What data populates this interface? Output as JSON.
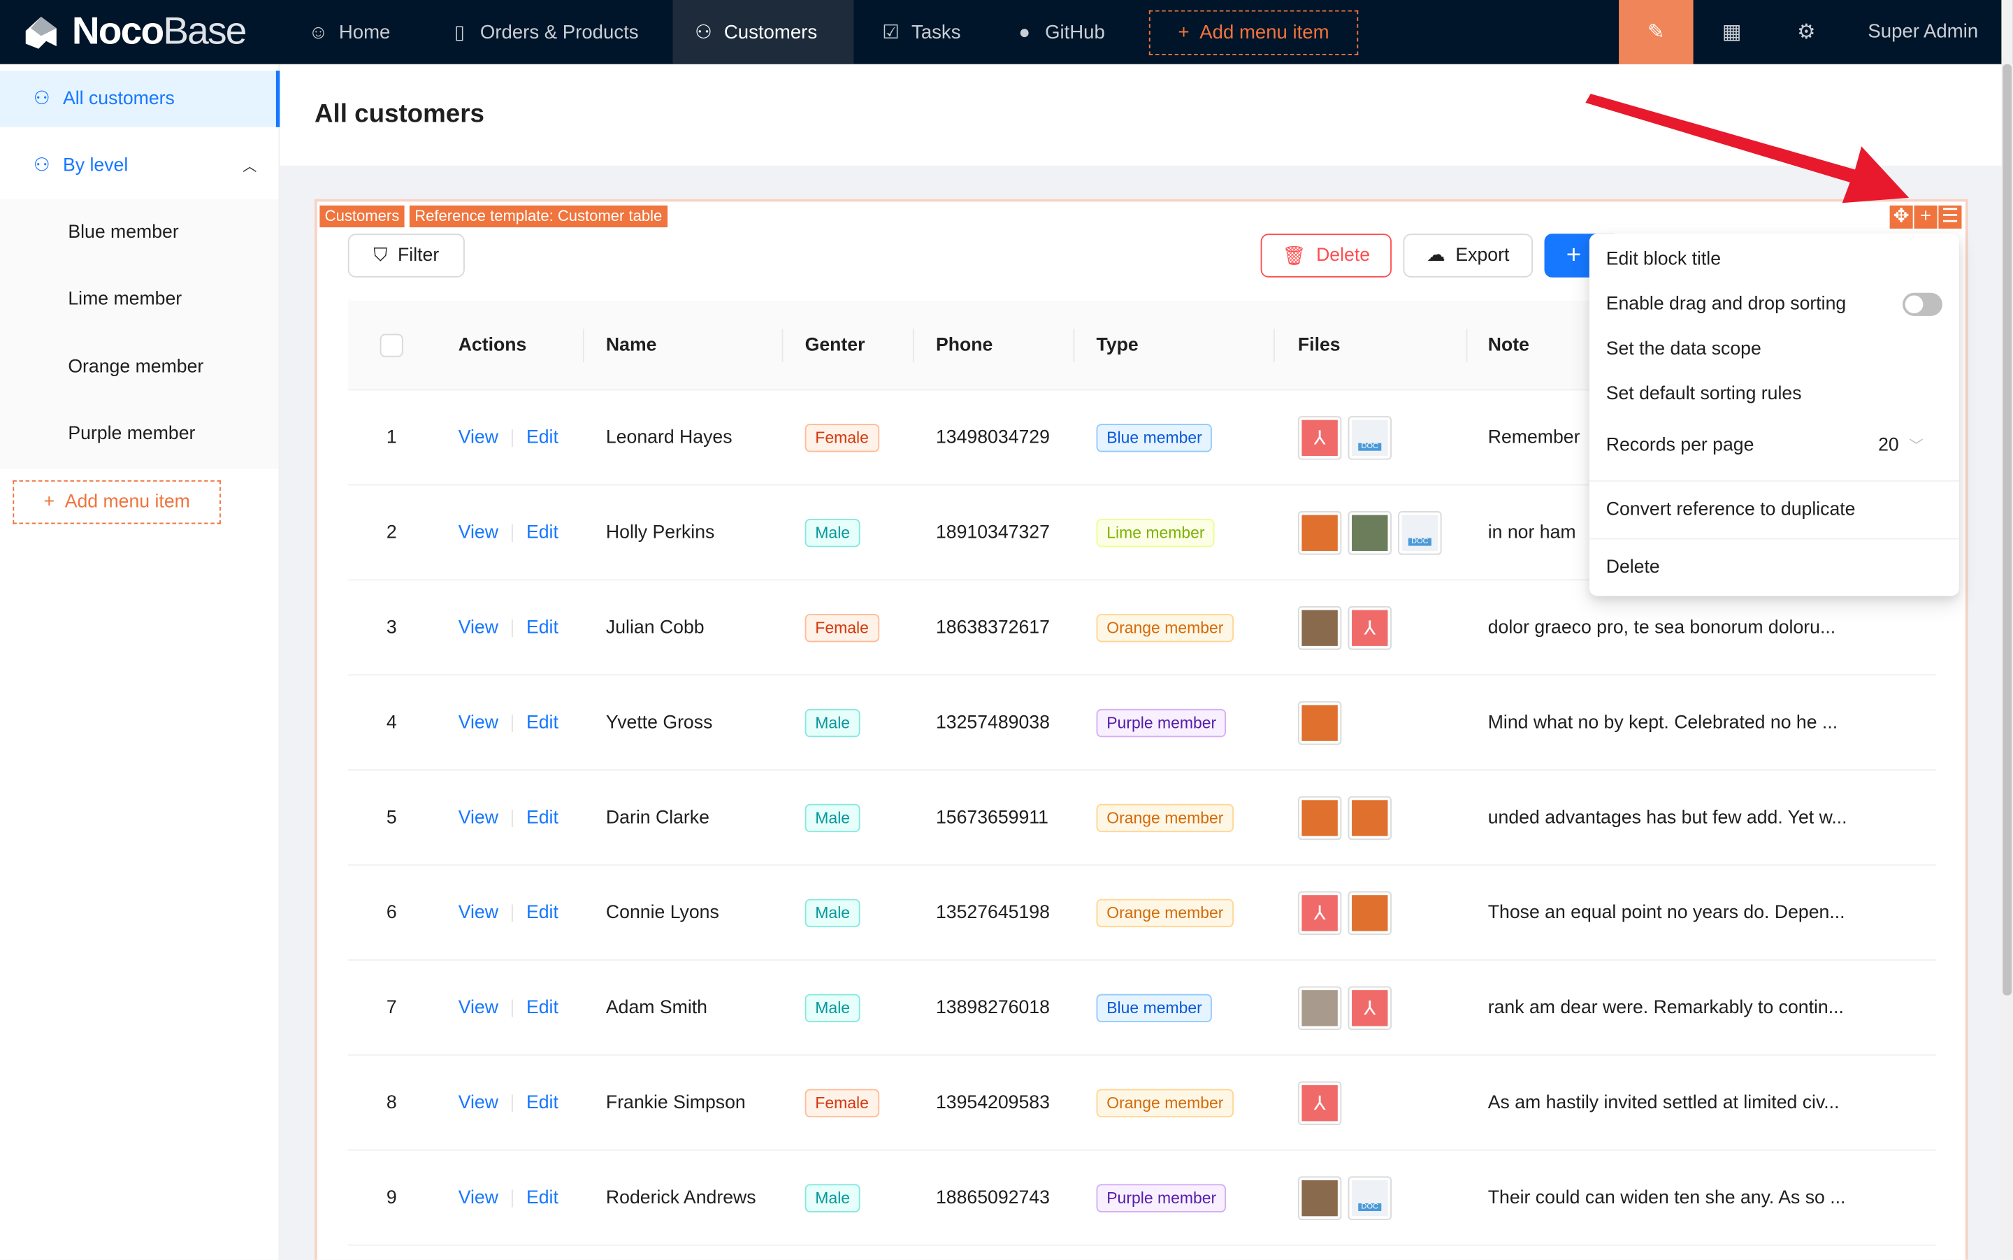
{
  "topbar": {
    "logo": {
      "bold": "Noco",
      "light": "Base"
    },
    "nav": [
      {
        "label": "Home",
        "icon": "smile-icon"
      },
      {
        "label": "Orders & Products",
        "icon": "file-check-icon"
      },
      {
        "label": "Customers",
        "icon": "users-icon",
        "active": true
      },
      {
        "label": "Tasks",
        "icon": "checkbox-icon"
      },
      {
        "label": "GitHub",
        "icon": "github-icon"
      }
    ],
    "add_menu_item": "Add menu item",
    "user": "Super Admin"
  },
  "sidebar": {
    "items": [
      {
        "label": "All customers",
        "selected": true
      },
      {
        "label": "By level",
        "expanded": true
      }
    ],
    "sub_items": [
      "Blue member",
      "Lime member",
      "Orange member",
      "Purple member"
    ],
    "add_menu_item": "Add menu item"
  },
  "page": {
    "title": "All customers"
  },
  "block": {
    "tags": [
      "Customers",
      "Reference template: Customer table"
    ],
    "filter": "Filter",
    "delete": "Delete",
    "export": "Export",
    "add": "+"
  },
  "table": {
    "columns": [
      "Actions",
      "Name",
      "Genter",
      "Phone",
      "Type",
      "Files",
      "Note"
    ],
    "view": "View",
    "edit": "Edit",
    "rows": [
      {
        "n": "1",
        "name": "Leonard Hayes",
        "gender": "Female",
        "phone": "13498034729",
        "type": "Blue member",
        "files": [
          "pdf",
          "doc"
        ],
        "note": "Remember"
      },
      {
        "n": "2",
        "name": "Holly Perkins",
        "gender": "Male",
        "phone": "18910347327",
        "type": "Lime member",
        "files": [
          "img-orange",
          "img-green",
          "doc"
        ],
        "note": "in nor ham"
      },
      {
        "n": "3",
        "name": "Julian Cobb",
        "gender": "Female",
        "phone": "18638372617",
        "type": "Orange member",
        "files": [
          "img-brown",
          "pdf"
        ],
        "note": "dolor graeco pro, te sea bonorum doloru..."
      },
      {
        "n": "4",
        "name": "Yvette Gross",
        "gender": "Male",
        "phone": "13257489038",
        "type": "Purple member",
        "files": [
          "img-orange"
        ],
        "note": "Mind what no by kept. Celebrated no he ..."
      },
      {
        "n": "5",
        "name": "Darin Clarke",
        "gender": "Male",
        "phone": "15673659911",
        "type": "Orange member",
        "files": [
          "img-orange",
          "img-orange"
        ],
        "note": "unded advantages has but few add. Yet w..."
      },
      {
        "n": "6",
        "name": "Connie Lyons",
        "gender": "Male",
        "phone": "13527645198",
        "type": "Orange member",
        "files": [
          "pdf",
          "img-orange"
        ],
        "note": "Those an equal point no years do. Depen..."
      },
      {
        "n": "7",
        "name": "Adam Smith",
        "gender": "Male",
        "phone": "13898276018",
        "type": "Blue member",
        "files": [
          "img-grey",
          "pdf"
        ],
        "note": "rank am dear were. Remarkably to contin..."
      },
      {
        "n": "8",
        "name": "Frankie Simpson",
        "gender": "Female",
        "phone": "13954209583",
        "type": "Orange member",
        "files": [
          "pdf"
        ],
        "note": "As am hastily invited settled at limited civ..."
      },
      {
        "n": "9",
        "name": "Roderick Andrews",
        "gender": "Male",
        "phone": "18865092743",
        "type": "Purple member",
        "files": [
          "img-brown",
          "doc"
        ],
        "note": "Their could can widen ten she any. As so ..."
      }
    ]
  },
  "menu": {
    "edit_title": "Edit block title",
    "drag_sort": "Enable drag and drop sorting",
    "drag_sort_enabled": false,
    "data_scope": "Set the data scope",
    "sort_rules": "Set default sorting rules",
    "records_label": "Records per page",
    "records_value": "20",
    "convert": "Convert reference to duplicate",
    "delete": "Delete"
  },
  "colors": {
    "accent": "#1677ff",
    "ui_editor": "#f0743d",
    "topbar": "#001529",
    "danger": "#ff4d4f",
    "arrow": "#e8192c"
  }
}
